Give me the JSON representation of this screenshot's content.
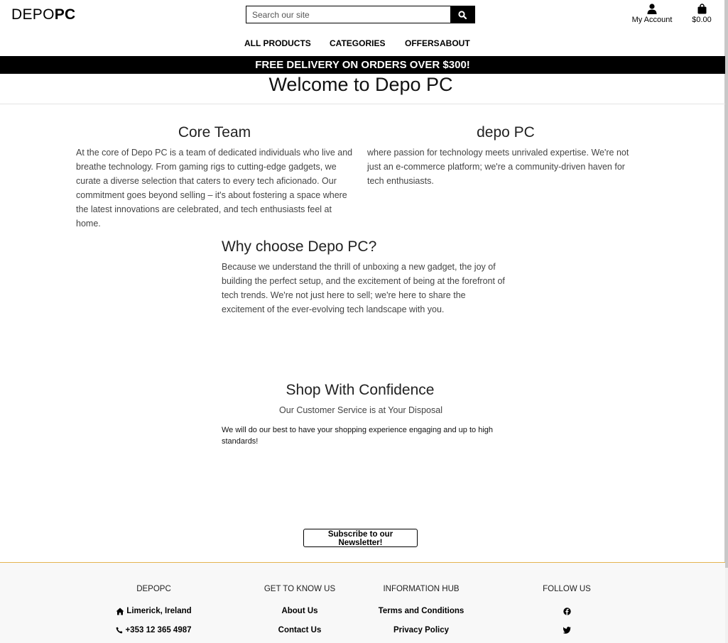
{
  "header": {
    "logo_main": "DEPO",
    "logo_accent": "PC",
    "search_placeholder": "Search our site",
    "account_label": "My Account",
    "cart_total": "$0.00"
  },
  "nav": {
    "all_products": "ALL PRODUCTS",
    "categories": "CATEGORIES",
    "offers": "OFFERS",
    "about": "ABOUT"
  },
  "banner": "FREE DELIVERY ON ORDERS OVER $300!",
  "page_title": "Welcome to Depo PC",
  "sections": {
    "core_team": {
      "title": "Core Team",
      "text": "At the core of Depo PC is a team of dedicated individuals who live and breathe technology. From gaming rigs to cutting-edge gadgets, we curate a diverse selection that caters to every tech aficionado. Our commitment goes beyond selling – it's about fostering a space where the latest innovations are celebrated, and tech enthusiasts feel at home."
    },
    "depo_pc": {
      "title": "depo PC",
      "text": "where passion for technology meets unrivaled expertise. We're not just an e-commerce platform; we're a community-driven haven for tech enthusiasts."
    },
    "why": {
      "title": "Why choose Depo PC?",
      "text": "Because we understand the thrill of unboxing a new gadget, the joy of building the perfect setup, and the excitement of being at the forefront of tech trends. We're not just here to sell; we're here to share the excitement of the ever-evolving tech landscape with you."
    },
    "shop": {
      "title": "Shop With Confidence",
      "subtitle": "Our Customer Service is at Your Disposal",
      "text": "We will do our best to have your shopping experience engaging and up to high standards!"
    }
  },
  "newsletter_button": "Subscribe to our Newsletter!",
  "footer": {
    "col1": {
      "title": "DEPOPC",
      "location": "Limerick, Ireland",
      "phone": "+353 12 365 4987"
    },
    "col2": {
      "title": "GET TO KNOW US",
      "about": "About Us",
      "contact": "Contact Us"
    },
    "col3": {
      "title": "INFORMATION HUB",
      "terms": "Terms and Conditions",
      "privacy": "Privacy Policy"
    },
    "col4": {
      "title": "FOLLOW US"
    }
  },
  "icons": {
    "search": "search-icon",
    "account": "user-icon",
    "cart": "shopping-bag-icon",
    "home": "home-icon",
    "phone": "phone-icon",
    "facebook": "facebook-icon",
    "twitter": "twitter-icon"
  },
  "colors": {
    "banner_bg": "#000000",
    "footer_line": "#e4b450"
  }
}
